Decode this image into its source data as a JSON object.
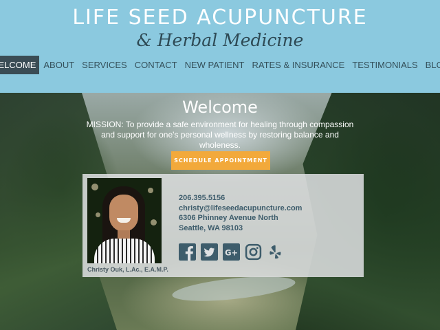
{
  "header": {
    "title": "LIFE SEED ACUPUNCTURE",
    "subtitle": "& Herbal Medicine"
  },
  "nav": {
    "items": [
      {
        "label": "WELCOME",
        "active": true
      },
      {
        "label": "ABOUT"
      },
      {
        "label": "SERVICES"
      },
      {
        "label": "CONTACT"
      },
      {
        "label": "NEW PATIENT"
      },
      {
        "label": "RATES & INSURANCE"
      },
      {
        "label": "TESTIMONIALS"
      },
      {
        "label": "BLOG"
      }
    ]
  },
  "hero": {
    "title": "Welcome",
    "mission": "MISSION: To provide a safe environment for healing through compassion and support for one's personal wellness by restoring balance and wholeness.",
    "cta_label": "SCHEDULE APPOINTMENT"
  },
  "card": {
    "photo_caption": "Christy Ouk, L.Ac., E.A.M.P.",
    "phone": "206.395.5156",
    "email": "christy@lifeseedacupuncture.com",
    "address_line1": "6306 Phinney Avenue North",
    "address_line2": "Seattle, WA 98103",
    "social_icons": [
      "facebook-icon",
      "twitter-icon",
      "google-plus-icon",
      "instagram-icon",
      "yelp-icon"
    ]
  },
  "colors": {
    "header_bg": "#8bc9df",
    "nav_active_bg": "#3a4c55",
    "cta_bg": "#f2a93b",
    "icon_color": "#3d5c6b"
  }
}
